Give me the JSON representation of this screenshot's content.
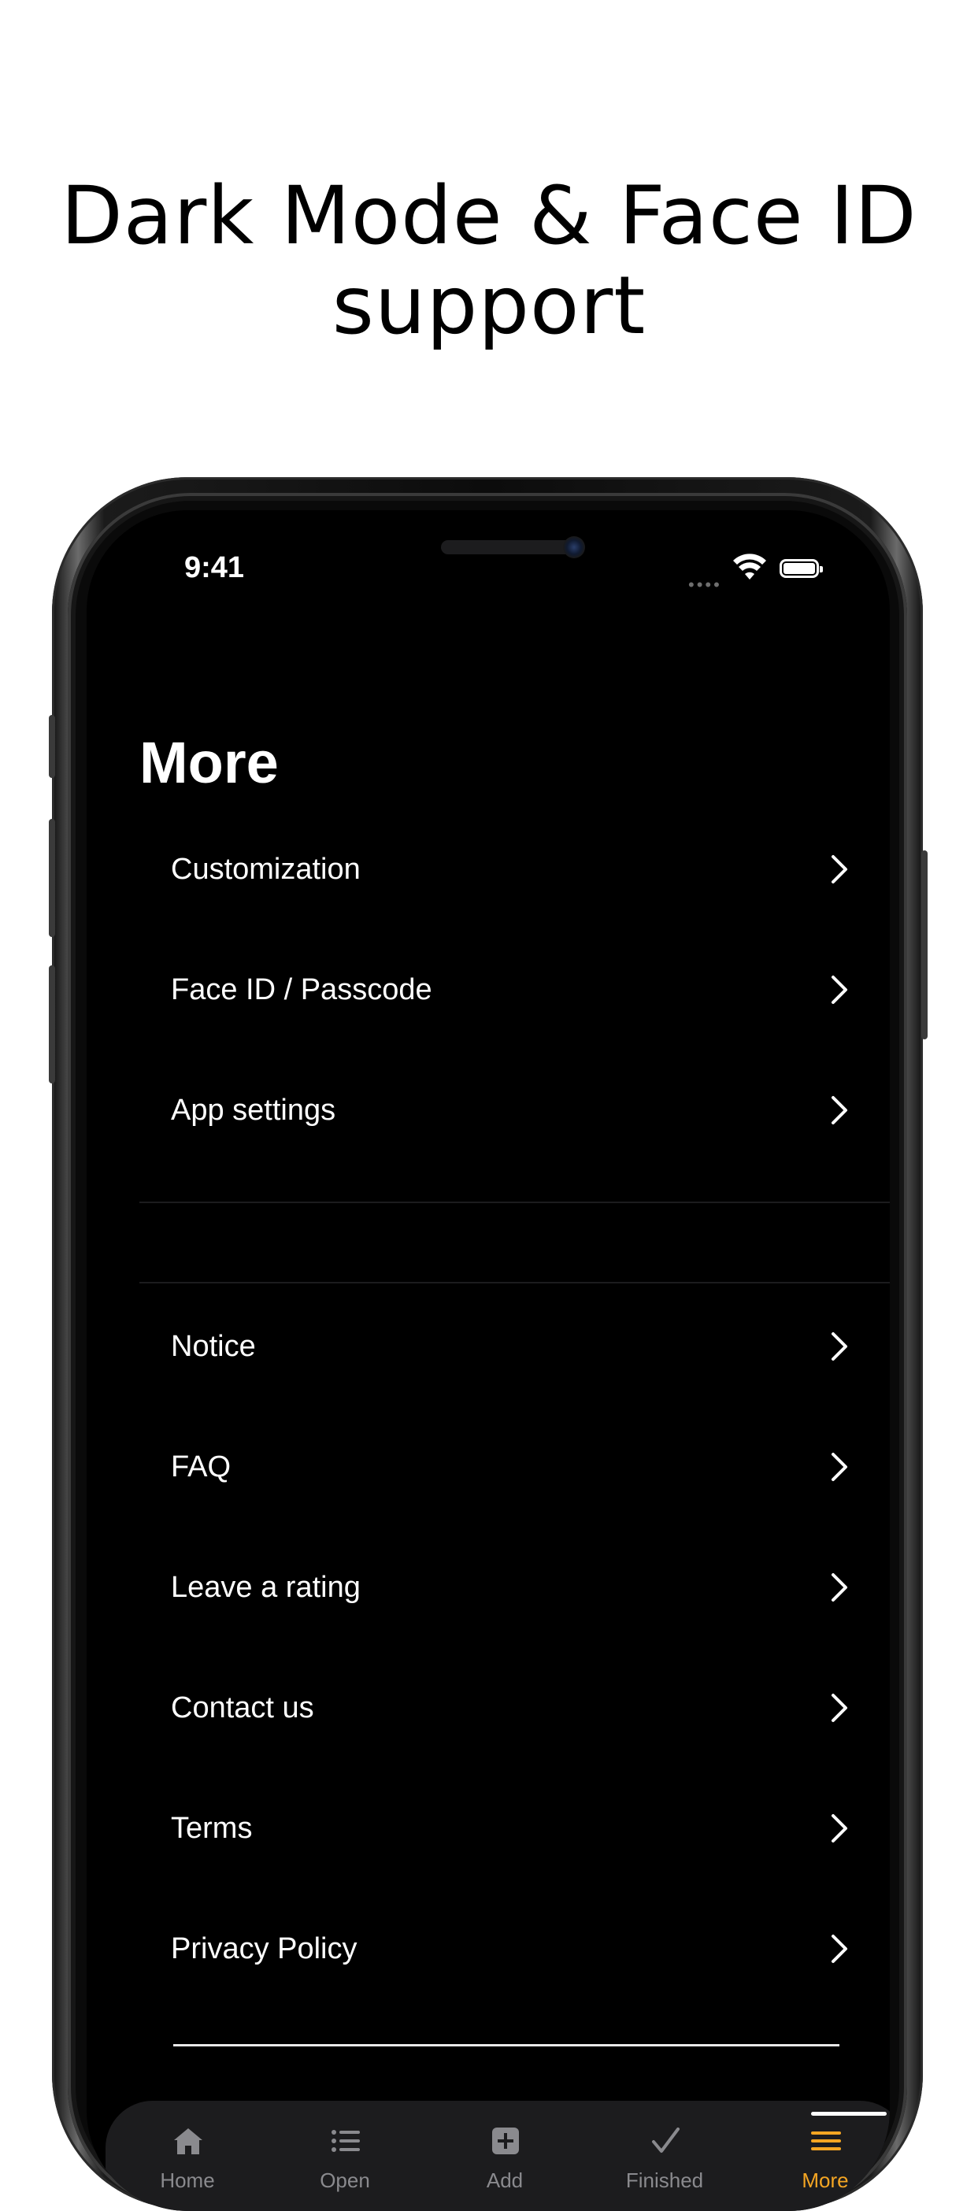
{
  "headline": {
    "line1": "Dark Mode & Face ID",
    "line2": "support"
  },
  "status_bar": {
    "time": "9:41",
    "signal": "••••"
  },
  "page_title": "More",
  "menu_group_1": [
    {
      "label": "Customization"
    },
    {
      "label": "Face ID / Passcode"
    },
    {
      "label": "App settings"
    }
  ],
  "menu_group_2": [
    {
      "label": "Notice"
    },
    {
      "label": "FAQ"
    },
    {
      "label": "Leave a rating"
    },
    {
      "label": "Contact us"
    },
    {
      "label": "Terms"
    },
    {
      "label": "Privacy Policy"
    }
  ],
  "tab_bar": {
    "items": [
      {
        "label": "Home",
        "icon": "house-icon"
      },
      {
        "label": "Open",
        "icon": "list-icon"
      },
      {
        "label": "Add",
        "icon": "plus-square-icon"
      },
      {
        "label": "Finished",
        "icon": "checkmark-icon"
      },
      {
        "label": "More",
        "icon": "hamburger-icon"
      }
    ],
    "active": "More",
    "active_color": "#f5a623",
    "inactive_color": "#8a8a8e"
  },
  "colors": {
    "screen_background": "#000000",
    "text": "#ffffff",
    "accent": "#f5a623"
  }
}
